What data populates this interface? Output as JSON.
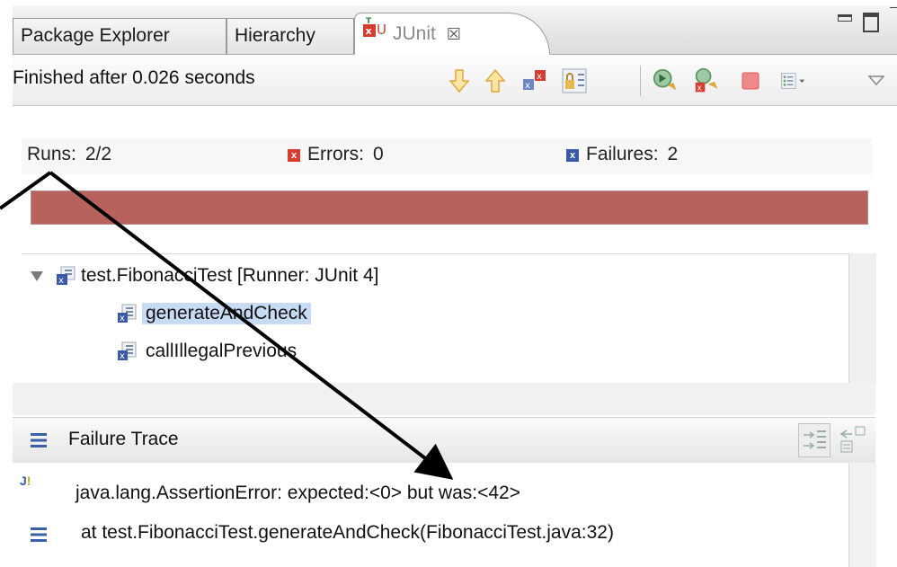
{
  "tabs": [
    {
      "label": "Package Explorer"
    },
    {
      "label": "Hierarchy"
    },
    {
      "label": "JUnit",
      "active": true
    }
  ],
  "toolbar": {
    "status": "Finished after 0.026 seconds",
    "icons": [
      "next-failure-icon",
      "previous-failure-icon",
      "show-failures-only-icon",
      "scroll-lock-icon",
      "rerun-test-icon",
      "rerun-failed-first-icon",
      "stop-icon",
      "test-run-history-icon",
      "view-menu-icon"
    ]
  },
  "counters": {
    "runs_label": "Runs:",
    "runs_value": "2/2",
    "errors_label": "Errors:",
    "errors_value": "0",
    "failures_label": "Failures:",
    "failures_value": "2"
  },
  "progress": {
    "fraction": 1.0,
    "color": "#b8625e"
  },
  "tree": {
    "root": "test.FibonacciTest [Runner: JUnit 4]",
    "children": [
      "generateAndCheck",
      "callIllegalPrevious"
    ],
    "selected": "generateAndCheck"
  },
  "failure_trace": {
    "title": "Failure Trace",
    "lines": [
      "java.lang.AssertionError: expected:<0> but was:<42>",
      "at test.FibonacciTest.generateAndCheck(FibonacciTest.java:32)"
    ]
  },
  "colors": {
    "accent": "#3b5ea8",
    "error": "#d63c30",
    "selection": "#c7dbf5"
  }
}
